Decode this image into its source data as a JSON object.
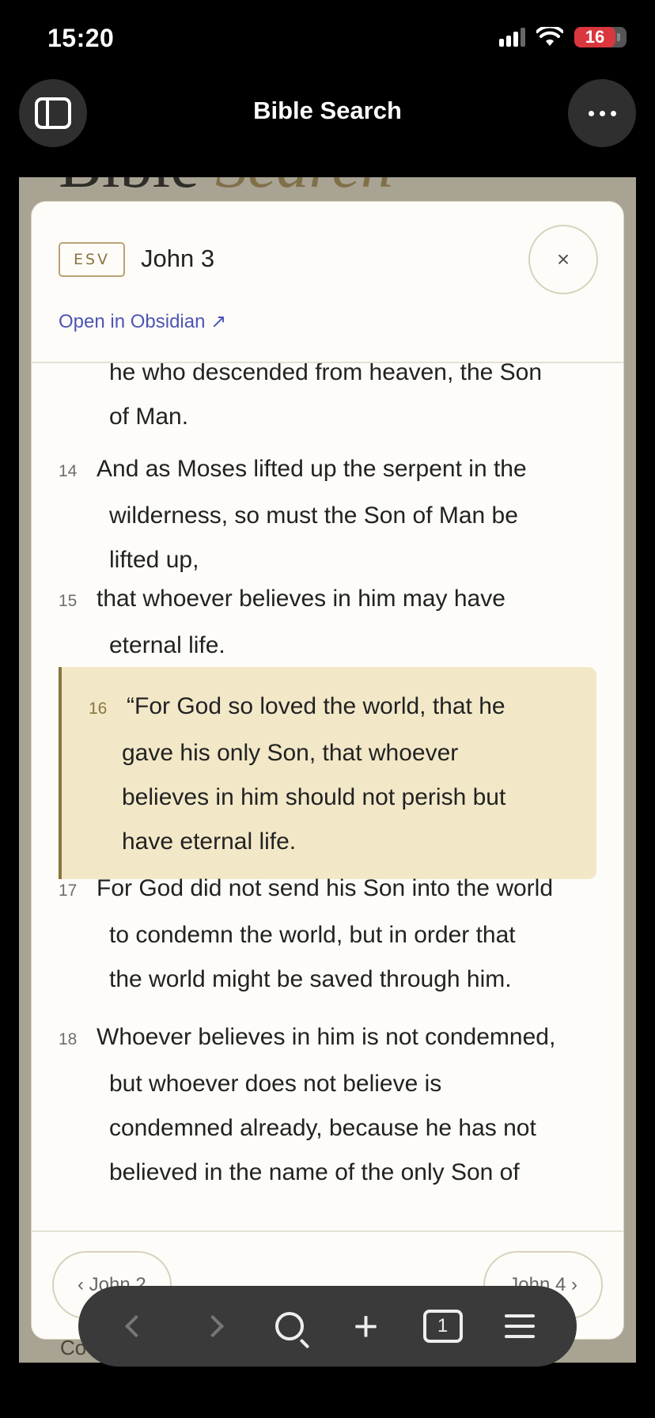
{
  "status_bar": {
    "time": "15:20",
    "battery": "16"
  },
  "browser": {
    "title": "Bible Search"
  },
  "background_page": {
    "heading_main": "Bible",
    "heading_accent": "Search",
    "bottom_text": "Co"
  },
  "modal": {
    "version": "ESV",
    "chapter": "John 3",
    "open_link": "Open in Obsidian ↗",
    "close_symbol": "×",
    "verses": {
      "v13_tail": {
        "lines": [
          "he who descended from heaven, the Son",
          "of Man."
        ]
      },
      "v14": {
        "num": "14",
        "lines": [
          "And as Moses lifted up the serpent in the",
          "wilderness, so must the Son of Man be",
          "lifted up,"
        ]
      },
      "v15": {
        "num": "15",
        "lines": [
          "that whoever believes in him may have",
          "eternal life."
        ]
      },
      "v16": {
        "num": "16",
        "lines": [
          "“For God so loved the world, that he",
          "gave his only Son, that whoever",
          "believes in him should not perish but",
          "have eternal life."
        ]
      },
      "v17": {
        "num": "17",
        "lines": [
          "For God did not send his Son into the world",
          "to condemn the world, but in order that",
          "the world might be saved through him."
        ]
      },
      "v18": {
        "num": "18",
        "lines": [
          "Whoever believes in him is not condemned,",
          "but whoever does not believe is",
          "condemned already, because he has not",
          "believed in the name of the only Son of"
        ]
      }
    },
    "footer": {
      "prev": "‹ John 2",
      "next": "John 4 ›"
    }
  },
  "toolbar": {
    "tab_count": "1"
  }
}
